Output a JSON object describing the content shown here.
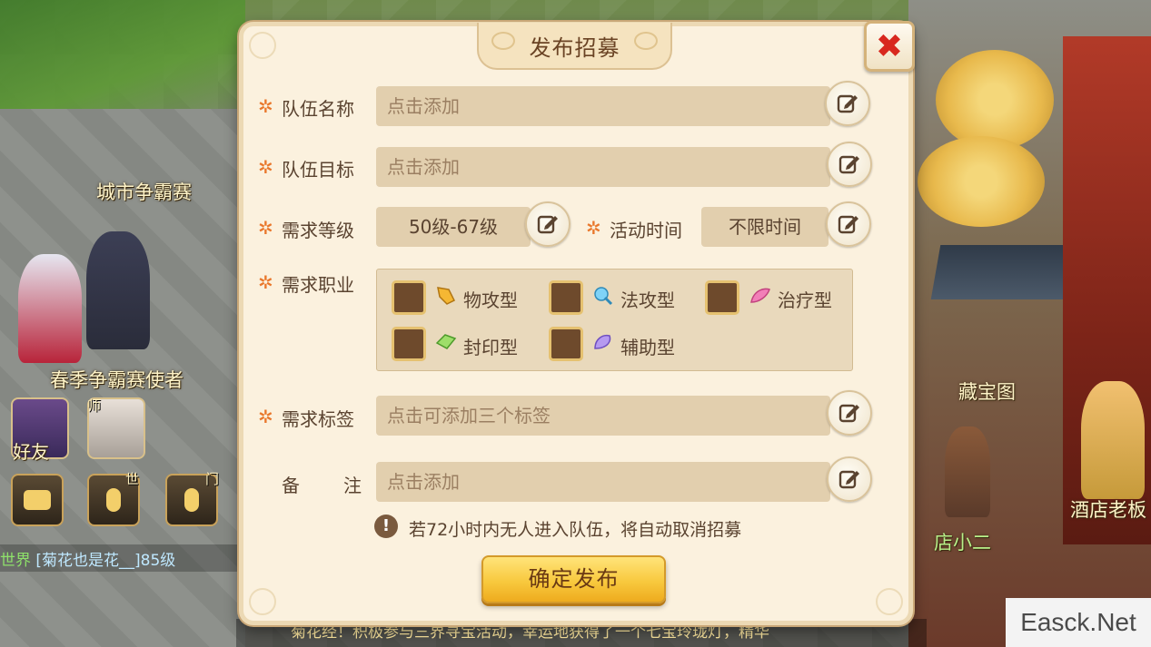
{
  "dialog": {
    "title": "发布招募",
    "close_symbol": "✖",
    "fields": {
      "team_name": {
        "label": "队伍名称",
        "placeholder": "点击添加"
      },
      "team_goal": {
        "label": "队伍目标",
        "placeholder": "点击添加"
      },
      "level_req": {
        "label": "需求等级",
        "value": "50级-67级"
      },
      "activity_time": {
        "label": "活动时间",
        "value": "不限时间"
      },
      "job_req": {
        "label": "需求职业"
      },
      "tags": {
        "label": "需求标签",
        "placeholder": "点击可添加三个标签"
      },
      "remark": {
        "label_a": "备",
        "label_b": "注",
        "placeholder": "点击添加"
      }
    },
    "required_mark": "✲",
    "jobs": [
      {
        "label": "物攻型",
        "icon": "sword-icon",
        "checked": false
      },
      {
        "label": "法攻型",
        "icon": "magic-icon",
        "checked": false
      },
      {
        "label": "治疗型",
        "icon": "heal-icon",
        "checked": false
      },
      {
        "label": "封印型",
        "icon": "seal-icon",
        "checked": false
      },
      {
        "label": "辅助型",
        "icon": "support-icon",
        "checked": false
      }
    ],
    "notice_icon": "!",
    "notice": "若72小时内无人进入队伍，将自动取消招募",
    "confirm_label": "确定发布"
  },
  "world": {
    "labels": {
      "city_contest": "城市争霸赛",
      "spring_envoy": "春季争霸赛使者",
      "treasure_map": "藏宝图",
      "hotel_boss": "酒店老板",
      "waiter": "店小二"
    },
    "friends_label": "好友",
    "master_label": "师",
    "world_tag": "世",
    "door_tag": "门",
    "chat": {
      "channel": "世界",
      "text": "[菊花也是花__]85级"
    },
    "broadcast": "菊花经！积极参与三界寻宝活动，幸运地获得了一个七宝玲珑灯，精华"
  },
  "watermark": "Easck.Net",
  "colors": {
    "accent": "#e9772b",
    "confirm": "#f8c93e",
    "close": "#d8281e"
  }
}
